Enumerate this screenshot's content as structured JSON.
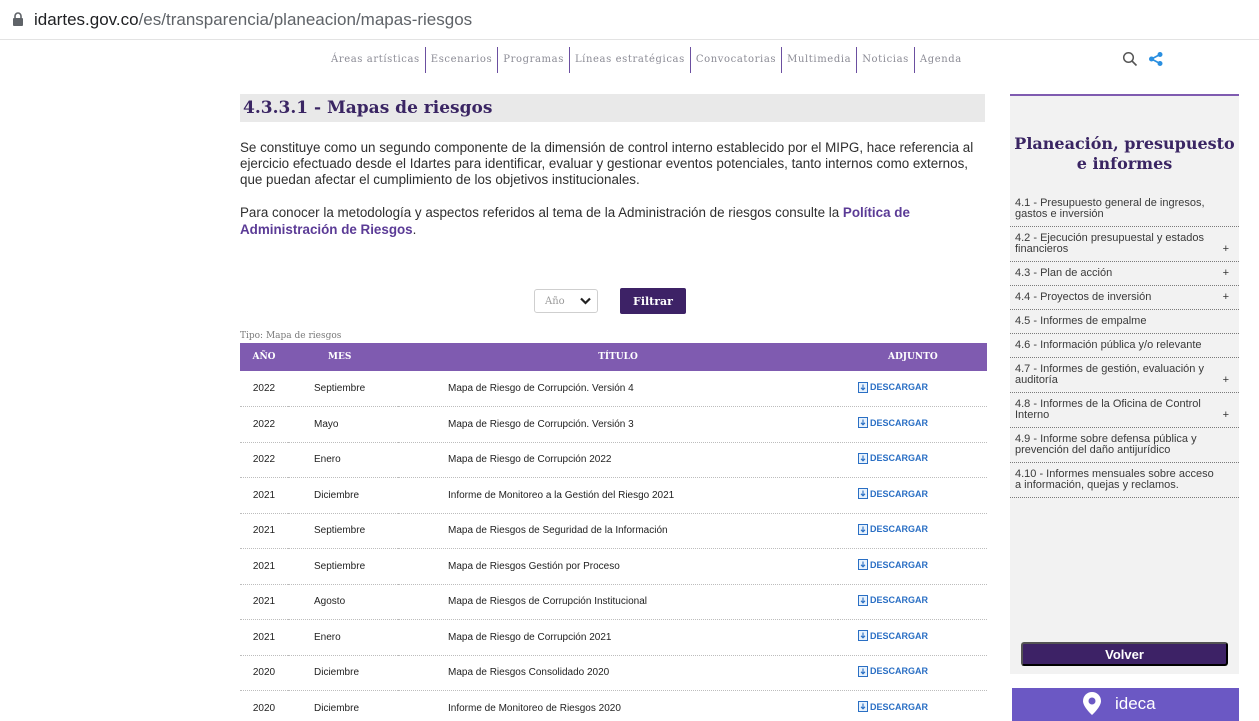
{
  "browser": {
    "domain": "idartes.gov.co",
    "path": "/es/transparencia/planeacion/mapas-riesgos"
  },
  "topnav": [
    "Áreas artísticas",
    "Escenarios",
    "Programas",
    "Líneas estratégicas",
    "Convocatorias",
    "Multimedia",
    "Noticias",
    "Agenda"
  ],
  "icons": {
    "search": "search-icon",
    "share": "share-icon",
    "lock": "lock-icon",
    "download": "download-icon",
    "chevron": "chevron-down-icon"
  },
  "colors": {
    "primary": "#3d2266",
    "table_header": "#7f5bb0",
    "link": "#2a6fc4"
  },
  "main": {
    "heading": "4.3.3.1 - Mapas de riesgos",
    "intro": "Se constituye como un segundo componente de la dimensión de control interno establecido por el MIPG, hace referencia al ejercicio efectuado desde el Idartes para identificar, evaluar y gestionar eventos potenciales, tanto internos como externos, que puedan afectar el cumplimiento de los objetivos institucionales.",
    "intro2_text": "Para conocer la metodología y aspectos referidos al tema de la Administración de riesgos consulte la",
    "intro2_link": "Política de Administración de Riesgos",
    "intro2_end": "."
  },
  "filter": {
    "select_value": "Año",
    "button": "Filtrar"
  },
  "table": {
    "tipo": "Tipo: Mapa de riesgos",
    "headers": [
      "Año",
      "Mes",
      "Título",
      "Adjunto"
    ],
    "download_label": "DESCARGAR",
    "rows": [
      {
        "anio": "2022",
        "mes": "Septiembre",
        "titulo": "Mapa de Riesgo de Corrupción. Versión 4"
      },
      {
        "anio": "2022",
        "mes": "Mayo",
        "titulo": "Mapa de Riesgo de Corrupción. Versión 3"
      },
      {
        "anio": "2022",
        "mes": "Enero",
        "titulo": "Mapa de Riesgo de Corrupción 2022"
      },
      {
        "anio": "2021",
        "mes": "Diciembre",
        "titulo": "Informe de Monitoreo a la Gestión del Riesgo 2021"
      },
      {
        "anio": "2021",
        "mes": "Septiembre",
        "titulo": "Mapa de Riesgos de Seguridad de la Información"
      },
      {
        "anio": "2021",
        "mes": "Septiembre",
        "titulo": "Mapa de Riesgos Gestión por Proceso"
      },
      {
        "anio": "2021",
        "mes": "Agosto",
        "titulo": "Mapa de Riesgos de Corrupción Institucional"
      },
      {
        "anio": "2021",
        "mes": "Enero",
        "titulo": "Mapa de Riesgo de Corrupción 2021"
      },
      {
        "anio": "2020",
        "mes": "Diciembre",
        "titulo": "Mapa de Riesgos Consolidado 2020"
      },
      {
        "anio": "2020",
        "mes": "Diciembre",
        "titulo": "Informe de Monitoreo de Riesgos 2020"
      }
    ]
  },
  "sidebar": {
    "title": "Planeación, presupuesto e informes",
    "items": [
      {
        "label": "4.1 - Presupuesto general de ingresos, gastos e inversión",
        "expand": ""
      },
      {
        "label": "4.2 - Ejecución presupuestal y estados financieros",
        "expand": "+"
      },
      {
        "label": "4.3 - Plan de acción",
        "expand": "+"
      },
      {
        "label": "4.4 - Proyectos de inversión",
        "expand": "+"
      },
      {
        "label": "4.5 - Informes de empalme",
        "expand": ""
      },
      {
        "label": "4.6 - Información pública y/o relevante",
        "expand": ""
      },
      {
        "label": "4.7 - Informes de gestión, evaluación y auditoría",
        "expand": "+"
      },
      {
        "label": "4.8 - Informes de la Oficina de Control Interno",
        "expand": "+"
      },
      {
        "label": "4.9 - Informe sobre defensa pública y prevención del daño antijurídico",
        "expand": ""
      },
      {
        "label": "4.10 - Informes mensuales sobre acceso a información, quejas y reclamos.",
        "expand": ""
      }
    ],
    "back_button": "Volver",
    "banner": "ideca"
  }
}
